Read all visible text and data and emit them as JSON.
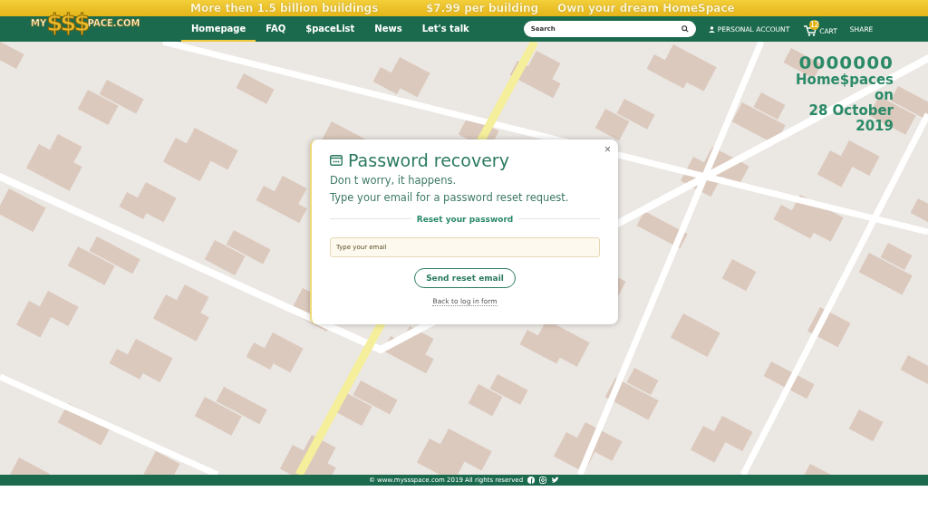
{
  "banner": [
    "More then 1.5 billion buildings",
    "$7.99 per building",
    "Own your dream HomeSpace"
  ],
  "logo": {
    "prefix": "MY",
    "mark": "$$$",
    "suffix": "PACE.COM"
  },
  "nav": [
    {
      "label": "Homepage",
      "selected": true
    },
    {
      "label": "FAQ",
      "selected": false
    },
    {
      "label": "$paceList",
      "selected": false
    },
    {
      "label": "News",
      "selected": false
    },
    {
      "label": "Let's talk",
      "selected": false
    }
  ],
  "search": {
    "placeholder": "Search"
  },
  "account": "PERSONAL ACCOUNT",
  "cart": {
    "label": "CART",
    "count": "12"
  },
  "share": "SHARE",
  "counter": {
    "value": "0000000",
    "lines": [
      "Home$paces",
      "on",
      "28 October",
      "2019"
    ]
  },
  "dialog": {
    "close": "×",
    "title": "Password recovery",
    "text": [
      "Don t worry, it happens.",
      "Type your email for a password reset request."
    ],
    "section": "Reset your password",
    "email": {
      "placeholder": "Type your email"
    },
    "button": "Send reset email",
    "link": "Back to log in form"
  },
  "footer": "© www.myssspace.com 2019 All rights reserved"
}
